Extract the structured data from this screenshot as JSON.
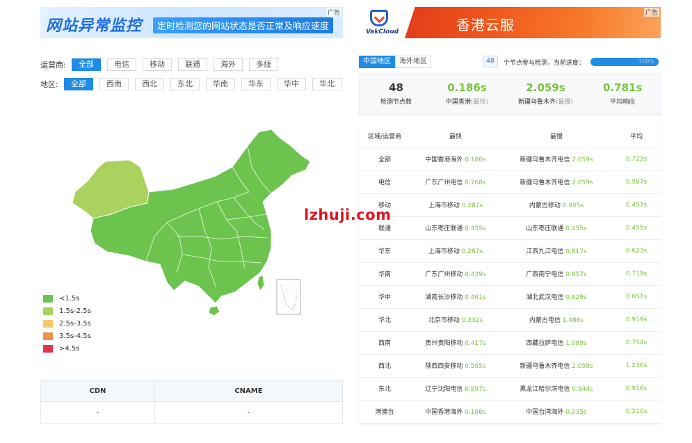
{
  "ad_left": {
    "headline": "网站异常监控",
    "subline": "定时检测您的网站状态是否正常及响应速度",
    "tag": "广告"
  },
  "ad_right": {
    "logo_text": "VakCloud",
    "headline": "香港云服",
    "tag": "广告"
  },
  "filters": {
    "isp_label": "运营商:",
    "isp_options": [
      "全部",
      "电信",
      "移动",
      "联通",
      "海外",
      "多线"
    ],
    "isp_selected": "全部",
    "region_label": "地区:",
    "region_options": [
      "全部",
      "西南",
      "西北",
      "东北",
      "华南",
      "华东",
      "华中",
      "华北"
    ],
    "region_selected": "全部"
  },
  "colors": {
    "accent": "#1f8ce4",
    "fast": "#6cc44e",
    "medium": "#a9d35e",
    "slow": "#f5c76a",
    "slower": "#f39048",
    "slowest": "#e0344a"
  },
  "legend": [
    {
      "label": "<1.5s",
      "color": "#6cc44e"
    },
    {
      "label": "1.5s-2.5s",
      "color": "#a9d35e"
    },
    {
      "label": "2.5s-3.5s",
      "color": "#f5c76a"
    },
    {
      "label": "3.5s-4.5s",
      "color": "#f39048"
    },
    {
      "label": ">4.5s",
      "color": "#e0344a"
    }
  ],
  "cdn_table": {
    "headers": [
      "CDN",
      "CNAME"
    ],
    "rows": [
      [
        "-",
        "-"
      ]
    ]
  },
  "region_tabs": [
    "中国地区",
    "海外地区"
  ],
  "region_tab_selected": "中国地区",
  "progress": {
    "node_count": "48",
    "label": "个节点参与检测，当前进度：",
    "value": 1.0,
    "percent_text": "100%"
  },
  "summary": {
    "total": {
      "value": "48",
      "label": "检测节点数"
    },
    "fastest": {
      "value": "0.186s",
      "label": "中国香港",
      "qualifier": "(最快)"
    },
    "slowest": {
      "value": "2.059s",
      "label": "新疆乌鲁木齐",
      "qualifier": "(最慢)"
    },
    "average": {
      "value": "0.781s",
      "label": "平均响应"
    }
  },
  "result_table": {
    "headers": [
      "区域/运营商",
      "最快",
      "最慢",
      "平均"
    ],
    "rows": [
      {
        "region": "全部",
        "fast_loc": "中国香港海外",
        "fast_time": "0.186s",
        "slow_loc": "新疆乌鲁木齐电信",
        "slow_time": "2.059s",
        "avg": "0.723s"
      },
      {
        "region": "电信",
        "fast_loc": "广东广州电信",
        "fast_time": "0.768s",
        "slow_loc": "新疆乌鲁木齐电信",
        "slow_time": "2.059s",
        "avg": "0.987s"
      },
      {
        "region": "移动",
        "fast_loc": "上海市移动",
        "fast_time": "0.287s",
        "slow_loc": "内蒙古移动",
        "slow_time": "0.905s",
        "avg": "0.457s"
      },
      {
        "region": "联通",
        "fast_loc": "山东枣庄联通",
        "fast_time": "0.455s",
        "slow_loc": "山东枣庄联通",
        "slow_time": "0.455s",
        "avg": "0.455s"
      },
      {
        "region": "华东",
        "fast_loc": "上海市移动",
        "fast_time": "0.287s",
        "slow_loc": "江西九江电信",
        "slow_time": "0.817s",
        "avg": "0.623s"
      },
      {
        "region": "华南",
        "fast_loc": "广东广州移动",
        "fast_time": "0.439s",
        "slow_loc": "广西南宁电信",
        "slow_time": "0.857s",
        "avg": "0.719s"
      },
      {
        "region": "华中",
        "fast_loc": "湖南长沙移动",
        "fast_time": "0.461s",
        "slow_loc": "湖北武汉电信",
        "slow_time": "0.829s",
        "avg": "0.651s"
      },
      {
        "region": "华北",
        "fast_loc": "北京市移动",
        "fast_time": "0.332s",
        "slow_loc": "内蒙古电信",
        "slow_time": "1.486s",
        "avg": "0.919s"
      },
      {
        "region": "西南",
        "fast_loc": "贵州贵阳移动",
        "fast_time": "0.417s",
        "slow_loc": "西藏拉萨电信",
        "slow_time": "1.089s",
        "avg": "0.754s"
      },
      {
        "region": "西北",
        "fast_loc": "陕西西安移动",
        "fast_time": "0.565s",
        "slow_loc": "新疆乌鲁木齐电信",
        "slow_time": "2.059s",
        "avg": "1.236s"
      },
      {
        "region": "东北",
        "fast_loc": "辽宁沈阳电信",
        "fast_time": "0.897s",
        "slow_loc": "黑龙江哈尔滨电信",
        "slow_time": "0.944s",
        "avg": "0.916s"
      },
      {
        "region": "港澳台",
        "fast_loc": "中国香港海外",
        "fast_time": "0.186s",
        "slow_loc": "中国台湾海外",
        "slow_time": "0.235s",
        "avg": "0.210s"
      }
    ]
  },
  "watermark": "lzhuji.com"
}
